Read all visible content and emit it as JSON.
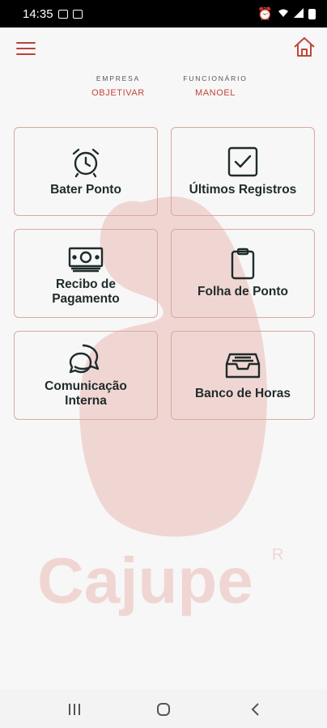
{
  "status_bar": {
    "time": "14:35"
  },
  "meta": {
    "company_label": "EMPRESA",
    "company_value": "OBJETIVAR",
    "employee_label": "FUNCIONÁRIO",
    "employee_value": "MANOEL"
  },
  "tiles": [
    {
      "label": "Bater Ponto",
      "icon": "alarm-clock-icon"
    },
    {
      "label": "Últimos Registros",
      "icon": "checkbox-icon"
    },
    {
      "label": "Recibo de Pagamento",
      "icon": "banknote-icon"
    },
    {
      "label": "Folha de Ponto",
      "icon": "clipboard-icon"
    },
    {
      "label": "Comunicação Interna",
      "icon": "chat-bubbles-icon"
    },
    {
      "label": "Banco de Horas",
      "icon": "inbox-tray-icon"
    }
  ],
  "watermark": {
    "brand": "Cajupe",
    "mark": "R"
  },
  "colors": {
    "accent": "#c0463a",
    "tile_border": "#d9a8a0",
    "text": "#1f2b2b",
    "watermark": "#f0d6d3"
  }
}
